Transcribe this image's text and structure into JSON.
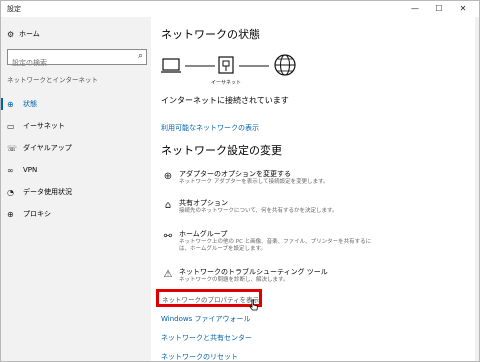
{
  "window": {
    "title": "設定",
    "minimize_glyph": "—",
    "maximize_glyph": "☐",
    "close_glyph": "✕"
  },
  "sidebar": {
    "home_label": "ホーム",
    "search_placeholder": "設定の検索",
    "section_label": "ネットワークとインターネット",
    "items": [
      {
        "label": "状態",
        "icon": "globe-status-icon",
        "active": true
      },
      {
        "label": "イーサネット",
        "icon": "ethernet-icon",
        "active": false
      },
      {
        "label": "ダイヤルアップ",
        "icon": "phone-icon",
        "active": false
      },
      {
        "label": "VPN",
        "icon": "vpn-icon",
        "active": false
      },
      {
        "label": "データ使用状況",
        "icon": "data-usage-icon",
        "active": false
      },
      {
        "label": "プロキシ",
        "icon": "globe-icon",
        "active": false
      }
    ]
  },
  "main": {
    "title": "ネットワークの状態",
    "diagram_label": "イーサネット",
    "status_text": "インターネットに接続されています",
    "available_networks_link": "利用可能なネットワークの表示",
    "settings_title": "ネットワーク設定の変更",
    "options": [
      {
        "title": "アダプターのオプションを変更する",
        "desc": "ネットワーク アダプターを表示して接続設定を変更します。",
        "icon": "adapter-icon"
      },
      {
        "title": "共有オプション",
        "desc": "接続先のネットワークについて、何を共有するかを決定します。",
        "icon": "sharing-icon"
      },
      {
        "title": "ホームグループ",
        "desc": "ネットワーク上の他の PC と画像、音楽、ファイル、プリンターを共有するには、ホームグループを設定します。",
        "icon": "homegroup-icon"
      },
      {
        "title": "ネットワークのトラブルシューティング ツール",
        "desc": "ネットワークの問題を診断し、解決します。",
        "icon": "warning-icon"
      }
    ],
    "links": [
      "ネットワークのプロパティを表示",
      "Windows ファイアウォール",
      "ネットワークと共有センター",
      "ネットワークのリセット"
    ]
  },
  "colors": {
    "accent": "#0063b1",
    "highlight": "#e00000"
  }
}
